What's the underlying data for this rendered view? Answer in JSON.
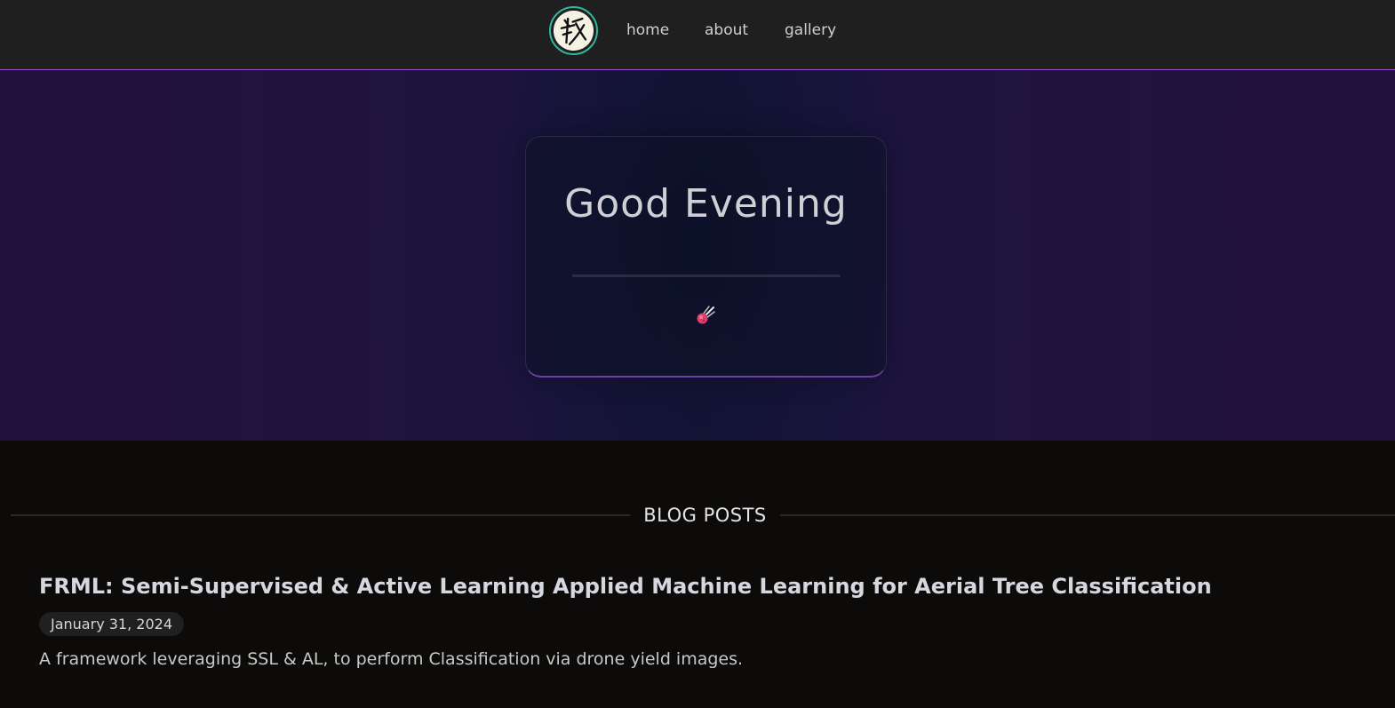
{
  "nav": {
    "logo_icon": "kanji-logo-icon",
    "links": [
      {
        "label": "home"
      },
      {
        "label": "about"
      },
      {
        "label": "gallery"
      }
    ]
  },
  "hero": {
    "greeting": "Good Evening",
    "icon": "comet-icon"
  },
  "blog": {
    "section_title": "BLOG POSTS",
    "posts": [
      {
        "title": "FRML: Semi-Supervised & Active Learning Applied Machine Learning for Aerial Tree Classification",
        "date": "January 31, 2024",
        "description": "A framework leveraging SSL & AL, to perform Classification via drone yield images."
      }
    ]
  },
  "colors": {
    "nav_background": "#1f1f1f",
    "nav_border": "#a24fd6",
    "logo_ring": "#2fb7a0",
    "hero_purple": "#25113e",
    "page_background": "#0c0b0a"
  }
}
